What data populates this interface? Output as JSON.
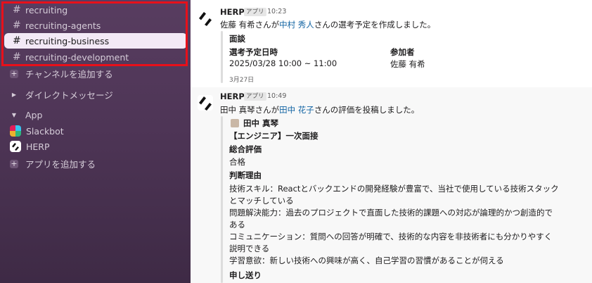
{
  "sidebar": {
    "channels": [
      {
        "name": "recruiting",
        "active": false
      },
      {
        "name": "recruiting-agents",
        "active": false
      },
      {
        "name": "recruiting-business",
        "active": true
      },
      {
        "name": "recruiting-development",
        "active": false
      }
    ],
    "add_channel": "チャンネルを追加する",
    "direct_messages": "ダイレクトメッセージ",
    "app_section": "App",
    "apps": [
      "Slackbot",
      "HERP"
    ],
    "add_app": "アプリを追加する"
  },
  "messages": [
    {
      "sender": "HERP",
      "badge": "アプリ",
      "time": "10:23",
      "text_before": "佐藤 有希さんが",
      "mention": "中村 秀人",
      "text_after": "さんの選考予定を作成しました。",
      "card": {
        "title": "面談",
        "col1_label": "選考予定日時",
        "col1_value": "2025/03/28 10:00 ~ 11:00",
        "col2_label": "参加者",
        "col2_value": "佐藤 有希",
        "footer": "3月27日"
      }
    },
    {
      "sender": "HERP",
      "badge": "アプリ",
      "time": "10:49",
      "text_before": "田中 真琴さんが",
      "mention": "田中 花子",
      "text_after": "さんの評価を投稿しました。",
      "card": {
        "author": "田中 真琴",
        "stage": "【エンジニア】一次面接",
        "overall_label": "総合評価",
        "overall_value": "合格",
        "reason_label": "判断理由",
        "reason_lines": [
          "技術スキル：Reactとバックエンドの開発経験が豊富で、当社で使用している技術スタック",
          "とマッチしている",
          "問題解決能力：過去のプロジェクトで直面した技術的課題への対応が論理的かつ創造的で",
          "ある",
          "コミュニケーション：質問への回答が明確で、技術的な内容を非技術者にも分かりやすく",
          "説明できる",
          "学習意欲：新しい技術への興味が高く、自己学習の習慣があることが伺える"
        ],
        "handover_label": "申し送り"
      }
    }
  ],
  "icons": [
    "hash-icon",
    "plus-icon",
    "caret-right-icon",
    "caret-down-icon",
    "slackbot-icon",
    "herp-logo-icon"
  ],
  "colors": {
    "sidebar_bg": "#4e3556",
    "active_channel_bg": "#f3e9f6",
    "highlight_border": "#e8101a",
    "link": "#1264a3"
  }
}
